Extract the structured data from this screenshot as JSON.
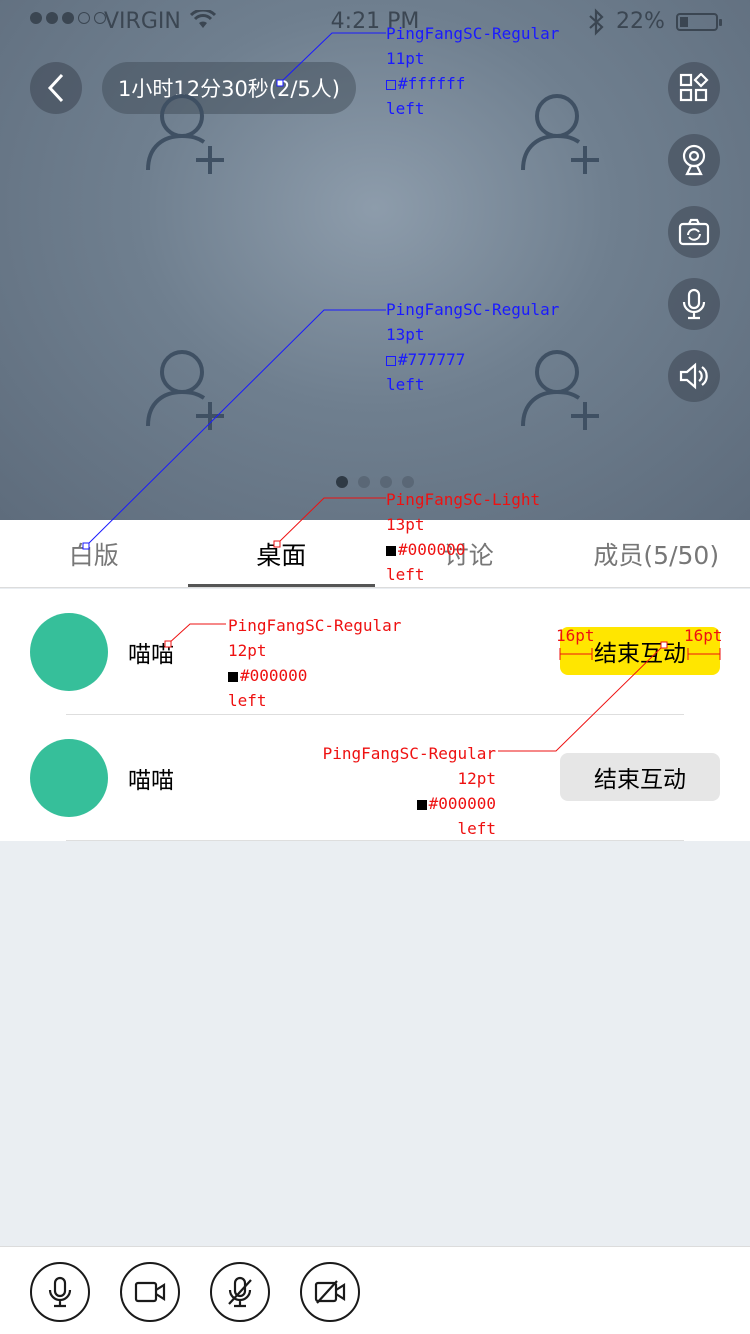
{
  "status_bar": {
    "carrier": "VIRGIN",
    "time": "4:21 PM",
    "battery": "22%",
    "signal_bars": 3,
    "signal_total": 5
  },
  "header": {
    "timer": "1小时12分30秒(2/5人)"
  },
  "pager": {
    "pages": 4,
    "active": 1
  },
  "tabs": [
    {
      "label": "白版"
    },
    {
      "label": "桌面",
      "active": true
    },
    {
      "label": "讨论"
    },
    {
      "label": "成员(5/50)"
    }
  ],
  "members": [
    {
      "name": "喵喵",
      "action": "结束互动",
      "highlight": true
    },
    {
      "name": "喵喵",
      "action": "结束互动",
      "highlight": false
    }
  ],
  "annotations": {
    "timer_spec": [
      "PingFangSC-Regular",
      "11pt",
      "#ffffff",
      "left"
    ],
    "tab_spec": [
      "PingFangSC-Regular",
      "13pt",
      "#777777",
      "left"
    ],
    "active_tab_spec": [
      "PingFangSC-Light",
      "13pt",
      "#000000",
      "left"
    ],
    "name_spec": [
      "PingFangSC-Regular",
      "12pt",
      "#000000",
      "left"
    ],
    "button_spec": [
      "PingFangSC-Regular",
      "12pt",
      "#000000",
      "left"
    ],
    "padding_left": "16pt",
    "padding_right": "16pt"
  },
  "colors": {
    "accent_yellow": "#ffe600",
    "avatar": "#36bf9a"
  },
  "icons": [
    "chevron-left-icon",
    "grid-icon",
    "webcam-icon",
    "camera-switch-icon",
    "microphone-icon",
    "speaker-icon",
    "add-user-icon",
    "mic-icon",
    "video-icon",
    "mic-off-icon",
    "video-off-icon"
  ]
}
